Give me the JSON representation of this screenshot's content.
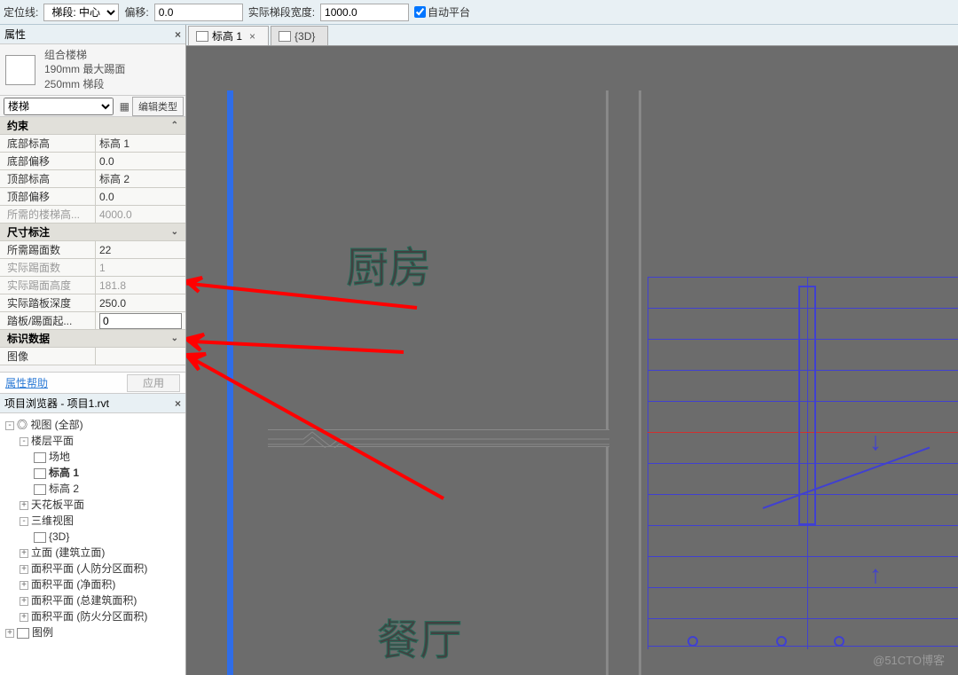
{
  "options_bar": {
    "locate_line_label": "定位线:",
    "locate_line_value": "梯段: 中心",
    "offset_label": "偏移:",
    "offset_value": "0.0",
    "run_width_label": "实际梯段宽度:",
    "run_width_value": "1000.0",
    "auto_landing": "自动平台"
  },
  "panels": {
    "properties_title": "属性",
    "browser_title": "项目浏览器 - 项目1.rvt"
  },
  "type_selector": {
    "line1": "组合楼梯",
    "line2": "190mm 最大踢面",
    "line3": "250mm 梯段"
  },
  "instance": {
    "category": "楼梯",
    "edit_type": "编辑类型"
  },
  "groups": {
    "constraints": "约束",
    "dimensions": "尺寸标注",
    "identity": "标识数据"
  },
  "props": {
    "base_level_label": "底部标高",
    "base_level_val": "标高 1",
    "base_offset_label": "底部偏移",
    "base_offset_val": "0.0",
    "top_level_label": "顶部标高",
    "top_level_val": "标高 2",
    "top_offset_label": "顶部偏移",
    "top_offset_val": "0.0",
    "desired_height_label": "所需的楼梯高...",
    "desired_height_val": "4000.0",
    "desired_risers_label": "所需踢面数",
    "desired_risers_val": "22",
    "actual_risers_label": "实际踢面数",
    "actual_risers_val": "1",
    "actual_riser_h_label": "实际踢面高度",
    "actual_riser_h_val": "181.8",
    "actual_tread_d_label": "实际踏板深度",
    "actual_tread_d_val": "250.0",
    "tread_riser_start_label": "踏板/踢面起...",
    "tread_riser_start_val": "0",
    "image_label": "图像"
  },
  "apply": {
    "help": "属性帮助",
    "apply_btn": "应用"
  },
  "tree": {
    "root": "视图 (全部)",
    "floor_plans": "楼层平面",
    "site": "场地",
    "level1": "标高 1",
    "level2": "标高 2",
    "ceiling_plans": "天花板平面",
    "three_d_views": "三维视图",
    "three_d": "{3D}",
    "elevations": "立面 (建筑立面)",
    "area1": "面积平面 (人防分区面积)",
    "area2": "面积平面 (净面积)",
    "area3": "面积平面 (总建筑面积)",
    "area4": "面积平面 (防火分区面积)",
    "legends": "图例"
  },
  "tabs": {
    "tab1": "标高 1",
    "tab2": "{3D}"
  },
  "rooms": {
    "kitchen": "厨房",
    "dining": "餐厅"
  },
  "watermark": "@51CTO博客"
}
